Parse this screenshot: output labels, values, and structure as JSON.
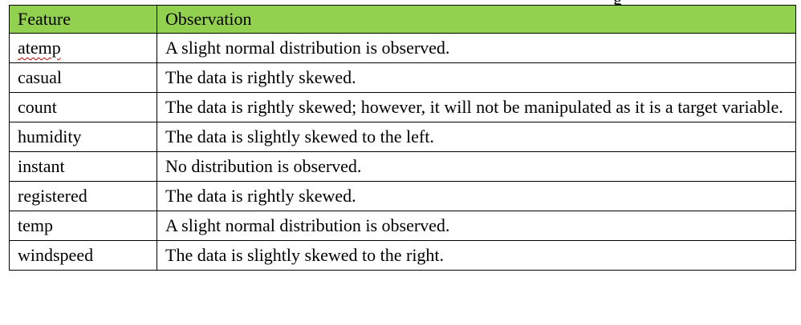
{
  "table": {
    "headers": [
      "Feature",
      "Observation"
    ],
    "rows": [
      {
        "feature": "atemp",
        "observation": "A slight normal distribution is observed."
      },
      {
        "feature": "casual",
        "observation": "The data is rightly skewed."
      },
      {
        "feature": "count",
        "observation": "The data is rightly skewed; however, it will not be manipulated as it is a target variable."
      },
      {
        "feature": "humidity",
        "observation": "The data is slightly skewed to the left."
      },
      {
        "feature": "instant",
        "observation": "No distribution is observed."
      },
      {
        "feature": "registered",
        "observation": "The data is rightly skewed."
      },
      {
        "feature": "temp",
        "observation": "A slight normal distribution is observed."
      },
      {
        "feature": "windspeed",
        "observation": "The data is slightly skewed to the right."
      }
    ]
  },
  "colors": {
    "header_background": "#92d050",
    "border": "#000000",
    "spellcheck_underline": "#c00000"
  }
}
